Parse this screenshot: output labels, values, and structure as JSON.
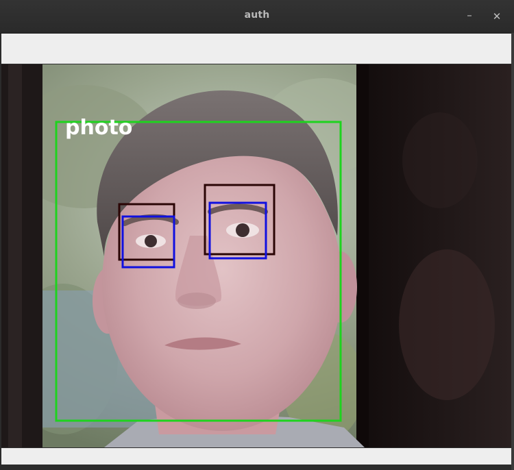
{
  "window": {
    "title": "auth",
    "minimize_glyph": "–",
    "close_glyph": "✕"
  },
  "camera_frame": {
    "label": "photo",
    "colors": {
      "face_box": "#1ed31e",
      "eye_box_dark": "#2a0505",
      "eye_box_blue": "#1010e0",
      "label_text": "#ffffff"
    }
  }
}
